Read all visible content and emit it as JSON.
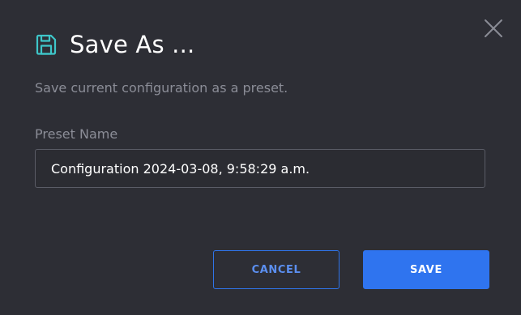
{
  "dialog": {
    "title": "Save As ...",
    "title_icon": "floppy-disk-icon",
    "close_icon": "close-icon",
    "subtitle": "Save current configuration as a preset.",
    "field": {
      "label": "Preset Name",
      "value": "Configuration 2024-03-08, 9:58:29 a.m."
    },
    "buttons": {
      "cancel_label": "CANCEL",
      "save_label": "SAVE"
    }
  },
  "colors": {
    "background": "#2d2e35",
    "accent": "#2f74ef",
    "icon_teal": "#3ec6c9",
    "muted_text": "#8b8d97",
    "input_border": "#5a5c66"
  }
}
